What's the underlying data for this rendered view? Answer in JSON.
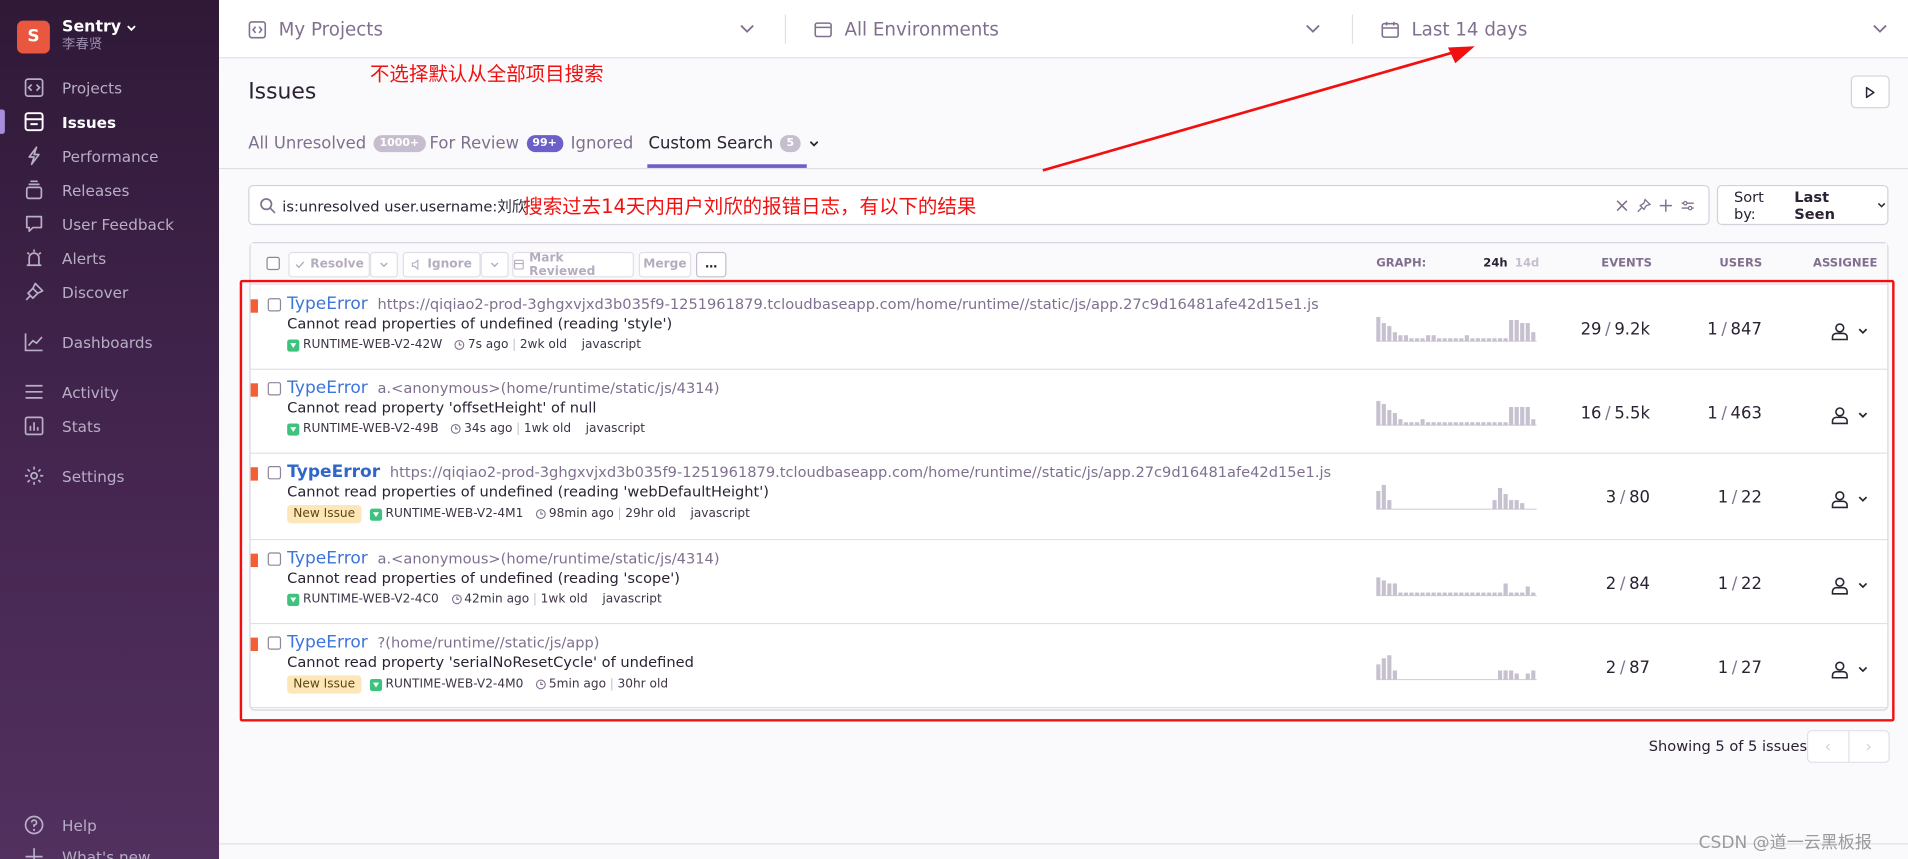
{
  "org": {
    "avatar_letter": "S",
    "name": "Sentry",
    "user": "李春贤"
  },
  "nav": {
    "items": [
      {
        "label": "Projects",
        "icon": "projects-icon"
      },
      {
        "label": "Issues",
        "icon": "issues-icon",
        "active": true
      },
      {
        "label": "Performance",
        "icon": "performance-icon"
      },
      {
        "label": "Releases",
        "icon": "releases-icon"
      },
      {
        "label": "User Feedback",
        "icon": "user-feedback-icon"
      },
      {
        "label": "Alerts",
        "icon": "alerts-icon"
      },
      {
        "label": "Discover",
        "icon": "discover-icon"
      },
      {
        "label": "Dashboards",
        "icon": "dashboards-icon"
      },
      {
        "label": "Activity",
        "icon": "activity-icon"
      },
      {
        "label": "Stats",
        "icon": "stats-icon"
      },
      {
        "label": "Settings",
        "icon": "settings-icon"
      },
      {
        "label": "Help",
        "icon": "help-icon"
      },
      {
        "label": "What's new",
        "icon": "whats-new-icon"
      }
    ]
  },
  "topbar": {
    "projects": "My Projects",
    "environments": "All Environments",
    "period": "Last 14 days"
  },
  "page": {
    "title": "Issues"
  },
  "tabs": [
    {
      "label": "All Unresolved",
      "badge": "1000+"
    },
    {
      "label": "For Review",
      "badge": "99+"
    },
    {
      "label": "Ignored",
      "badge": ""
    },
    {
      "label": "Custom Search",
      "badge": "5"
    }
  ],
  "annotations": {
    "top": "不选择默认从全部项目搜索",
    "search": "搜索过去14天内用户刘欣的报错日志，有以下的结果"
  },
  "search": {
    "query": "is:unresolved user.username:刘欣"
  },
  "sort": {
    "label": "Sort by:",
    "value": "Last Seen"
  },
  "toolbar": {
    "resolve": "Resolve",
    "ignore": "Ignore",
    "mark_reviewed": "Mark Reviewed",
    "merge": "Merge",
    "more": "…"
  },
  "columns": {
    "graph": "GRAPH:",
    "period_24h": "24h",
    "period_14d": "14d",
    "events": "EVENTS",
    "users": "USERS",
    "assignee": "ASSIGNEE"
  },
  "issues": [
    {
      "type": "TypeError",
      "location": "https://qiqiao2-prod-3ghgxvjxd3b035f9-1251961879.tcloudbaseapp.com/home/runtime//static/js/app.27c9d16481afe42d15e1.js",
      "message": "Cannot read properties of undefined (reading 'style')",
      "new_badge": "",
      "short_id": "RUNTIME-WEB-V2-42W",
      "last_seen": "7s ago",
      "age": "2wk old",
      "platform": "javascript",
      "events": "29",
      "events_total": "9.2k",
      "users": "1",
      "users_total": "847",
      "bold": false,
      "spark": [
        8,
        6,
        5,
        3,
        2,
        2,
        1,
        1,
        1,
        2,
        2,
        1,
        1,
        1,
        1,
        1,
        2,
        1,
        1,
        1,
        1,
        1,
        1,
        1,
        7,
        7,
        6,
        6,
        3
      ]
    },
    {
      "type": "TypeError",
      "location": "a.<anonymous>(home/runtime/static/js/4314)",
      "message": "Cannot read property 'offsetHeight' of null",
      "new_badge": "",
      "short_id": "RUNTIME-WEB-V2-49B",
      "last_seen": "34s ago",
      "age": "1wk old",
      "platform": "javascript",
      "events": "16",
      "events_total": "5.5k",
      "users": "1",
      "users_total": "463",
      "bold": false,
      "spark": [
        8,
        7,
        5,
        4,
        2,
        1,
        1,
        1,
        2,
        1,
        1,
        1,
        1,
        1,
        1,
        1,
        1,
        1,
        1,
        1,
        1,
        1,
        1,
        1,
        6,
        6,
        6,
        6,
        2
      ]
    },
    {
      "type": "TypeError",
      "location": "https://qiqiao2-prod-3ghgxvjxd3b035f9-1251961879.tcloudbaseapp.com/home/runtime//static/js/app.27c9d16481afe42d15e1.js",
      "message": "Cannot read properties of undefined (reading 'webDefaultHeight')",
      "new_badge": "New Issue",
      "short_id": "RUNTIME-WEB-V2-4M1",
      "last_seen": "98min ago",
      "age": "29hr old",
      "platform": "javascript",
      "events": "3",
      "events_total": "80",
      "users": "1",
      "users_total": "22",
      "bold": true,
      "spark": [
        6,
        8,
        3,
        0,
        0,
        0,
        0,
        0,
        0,
        0,
        0,
        0,
        0,
        0,
        0,
        0,
        0,
        0,
        0,
        0,
        0,
        3,
        7,
        5,
        3,
        3,
        2,
        0,
        0
      ]
    },
    {
      "type": "TypeError",
      "location": "a.<anonymous>(home/runtime/static/js/4314)",
      "message": "Cannot read properties of undefined (reading 'scope')",
      "new_badge": "",
      "short_id": "RUNTIME-WEB-V2-4C0",
      "last_seen": "42min ago",
      "age": "1wk old",
      "platform": "javascript",
      "events": "2",
      "events_total": "84",
      "users": "1",
      "users_total": "22",
      "bold": false,
      "spark": [
        6,
        5,
        4,
        4,
        1,
        1,
        1,
        1,
        1,
        1,
        1,
        1,
        1,
        1,
        1,
        1,
        1,
        1,
        1,
        1,
        1,
        1,
        1,
        4,
        1,
        1,
        1,
        3,
        1
      ]
    },
    {
      "type": "TypeError",
      "location": "?(home/runtime//static/js/app)",
      "message": "Cannot read property 'serialNoResetCycle' of undefined",
      "new_badge": "New Issue",
      "short_id": "RUNTIME-WEB-V2-4M0",
      "last_seen": "5min ago",
      "age": "30hr old",
      "platform": "",
      "events": "2",
      "events_total": "87",
      "users": "1",
      "users_total": "27",
      "bold": false,
      "spark": [
        5,
        7,
        8,
        3,
        0,
        0,
        0,
        0,
        0,
        0,
        0,
        0,
        0,
        0,
        0,
        0,
        0,
        0,
        0,
        0,
        0,
        0,
        3,
        3,
        3,
        2,
        0,
        2,
        3
      ]
    }
  ],
  "pagination": {
    "summary": "Showing 5 of 5 issues",
    "prev": "‹",
    "next": "›"
  },
  "watermark": "CSDN @道一云黑板报",
  "colors": {
    "accent": "#6c5fc7",
    "link": "#3d74db",
    "level_error": "#f55d35",
    "annotation": "#f01010",
    "sidebar": "#3b2244"
  }
}
